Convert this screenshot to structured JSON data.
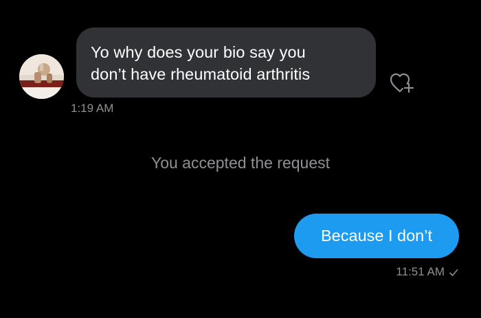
{
  "conversation": {
    "incoming": {
      "lines": [
        "Yo why does your bio say you",
        "don’t have rheumatoid arthritis"
      ],
      "timestamp": "1:19 AM",
      "avatar_icon": "profile-photo",
      "reaction_icon": "heart-plus-icon"
    },
    "system_message": "You accepted the request",
    "outgoing": {
      "text": "Because I don’t",
      "timestamp": "11:51 AM",
      "status_icon": "checkmark-icon"
    }
  },
  "colors": {
    "background": "#000000",
    "incoming_bubble": "#303235",
    "outgoing_bubble": "#1d9bf0",
    "muted_text": "#8d9196"
  }
}
